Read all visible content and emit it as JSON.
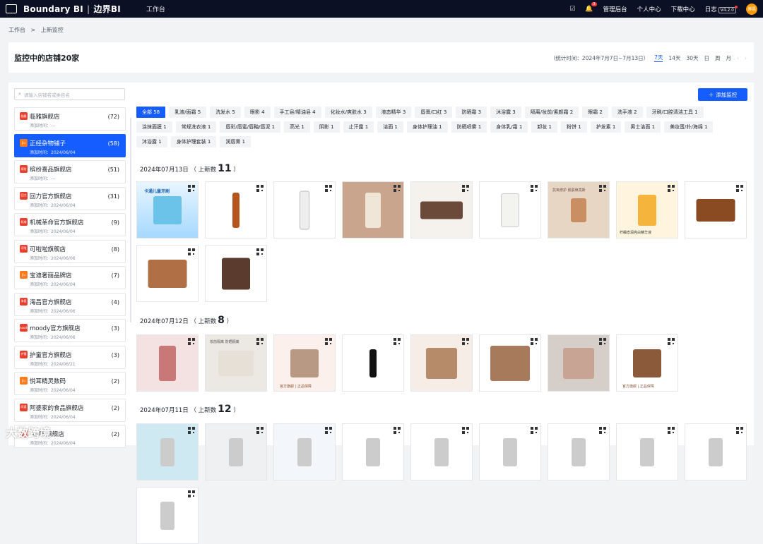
{
  "topbar": {
    "brand": "Boundary BI",
    "brand_cn": "边界BI",
    "nav_workbench": "工作台",
    "notification_count": "3",
    "admin": "管理后台",
    "profile": "个人中心",
    "download": "下载中心",
    "log": "日志",
    "version": "V4.2.0",
    "avatar_text": "博昌"
  },
  "breadcrumb": {
    "home": "工作台",
    "sep": ">",
    "current": "上新监控"
  },
  "header": {
    "title": "监控中的店铺20家",
    "range_label": "（统计时间：2024年7月7日~7月13日）",
    "ranges": [
      "7天",
      "14天",
      "30天",
      "日",
      "周",
      "月"
    ],
    "prev": "‹",
    "next": "›"
  },
  "search": {
    "placeholder": "请输入店铺名或类目名"
  },
  "add_button": "添加监控",
  "stores": [
    {
      "name": "临雅旗舰店",
      "date": "添加时间：---",
      "count": "(72)",
      "badge_color": "#e8402f",
      "badge": "临雅"
    },
    {
      "name": "正经杂物铺子",
      "date": "添加时间：2024/06/04",
      "count": "(58)",
      "badge_color": "#ff7a1a",
      "badge": "Jiu"
    },
    {
      "name": "缤纷喜品旗舰店",
      "date": "添加时间：---",
      "count": "(51)",
      "badge_color": "#e8402f",
      "badge": "缤纷"
    },
    {
      "name": "回力官方旗舰店",
      "date": "添加时间：2024/06/04",
      "count": "(31)",
      "badge_color": "#e8402f",
      "badge": "回力"
    },
    {
      "name": "机械革命官方旗舰店",
      "date": "添加时间：2024/06/04",
      "count": "(9)",
      "badge_color": "#e8402f",
      "badge": "机械"
    },
    {
      "name": "可啦啦旗舰店",
      "date": "添加时间：2024/06/06",
      "count": "(8)",
      "badge_color": "#e8402f",
      "badge": "可啦"
    },
    {
      "name": "宝迪奢丽品牌店",
      "date": "添加时间：2024/06/04",
      "count": "(7)",
      "badge_color": "#ff7a1a",
      "badge": "Jiu"
    },
    {
      "name": "海昌官方旗舰店",
      "date": "添加时间：2024/06/06",
      "count": "(4)",
      "badge_color": "#e8402f",
      "badge": "海昌"
    },
    {
      "name": "moody官方旗舰店",
      "date": "添加时间：2024/06/06",
      "count": "(3)",
      "badge_color": "#e8402f",
      "badge": "moody"
    },
    {
      "name": "护童官方旗舰店",
      "date": "添加时间：2024/06/21",
      "count": "(3)",
      "badge_color": "#e8402f",
      "badge": "护童"
    },
    {
      "name": "悦耳精灵数码",
      "date": "添加时间：2024/06/04",
      "count": "(2)",
      "badge_color": "#ff7a1a",
      "badge": "Jiu"
    },
    {
      "name": "阿婆家的食品旗舰店",
      "date": "添加时间：2024/06/04",
      "count": "(2)",
      "badge_color": "#e8402f",
      "badge": "阿婆"
    },
    {
      "name": "OATH旗舰店",
      "date": "添加时间：2024/06/04",
      "count": "(2)",
      "badge_color": "#e8402f",
      "badge": "OATH"
    }
  ],
  "tags": [
    "全部 58",
    "乳液/面霜 5",
    "洗发水 5",
    "眼影 4",
    "手工皂/精油皂 4",
    "化妆水/爽肤水 3",
    "液态精华 3",
    "唇膏/口红 3",
    "防晒霜 3",
    "沐浴露 3",
    "隔离/妆前/素颜霜 2",
    "眼霜 2",
    "洗手液 2",
    "牙刷/口腔清洁工具 1",
    "涂抹面膜 1",
    "常规洗衣液 1",
    "唇彩/唇蜜/唇釉/唇泥 1",
    "高光 1",
    "阴影 1",
    "止汗露 1",
    "洁面 1",
    "身体护理油 1",
    "防晒喷雾 1",
    "身体乳/霜 1",
    "卸妆 1",
    "粉饼 1",
    "护发素 1",
    "男士洁面 1",
    "美妆蛋/扑/海绵 1",
    "沐浴露 1",
    "身体护理套装 1",
    "润唇膏 1"
  ],
  "groups": [
    {
      "date": "2024年07月13日",
      "label": "（ 上新数",
      "count": "11",
      "close": "）"
    },
    {
      "date": "2024年07月12日",
      "label": "（ 上新数",
      "count": "8",
      "close": "）"
    },
    {
      "date": "2024年07月11日",
      "label": "（ 上新数",
      "count": "12",
      "close": "）"
    }
  ],
  "thumb_captions": {
    "toothbrush_title": "卡通儿童牙刷",
    "serum_caption": "柠檬皮润亮白精华液",
    "shop_caption": "官方旗舰 | 正品保障",
    "cream_caption": "抗氧修护 肌肤焕亮新",
    "primer_caption": "妆前隔离 防晒隔离"
  },
  "watermark": "大数跨境"
}
